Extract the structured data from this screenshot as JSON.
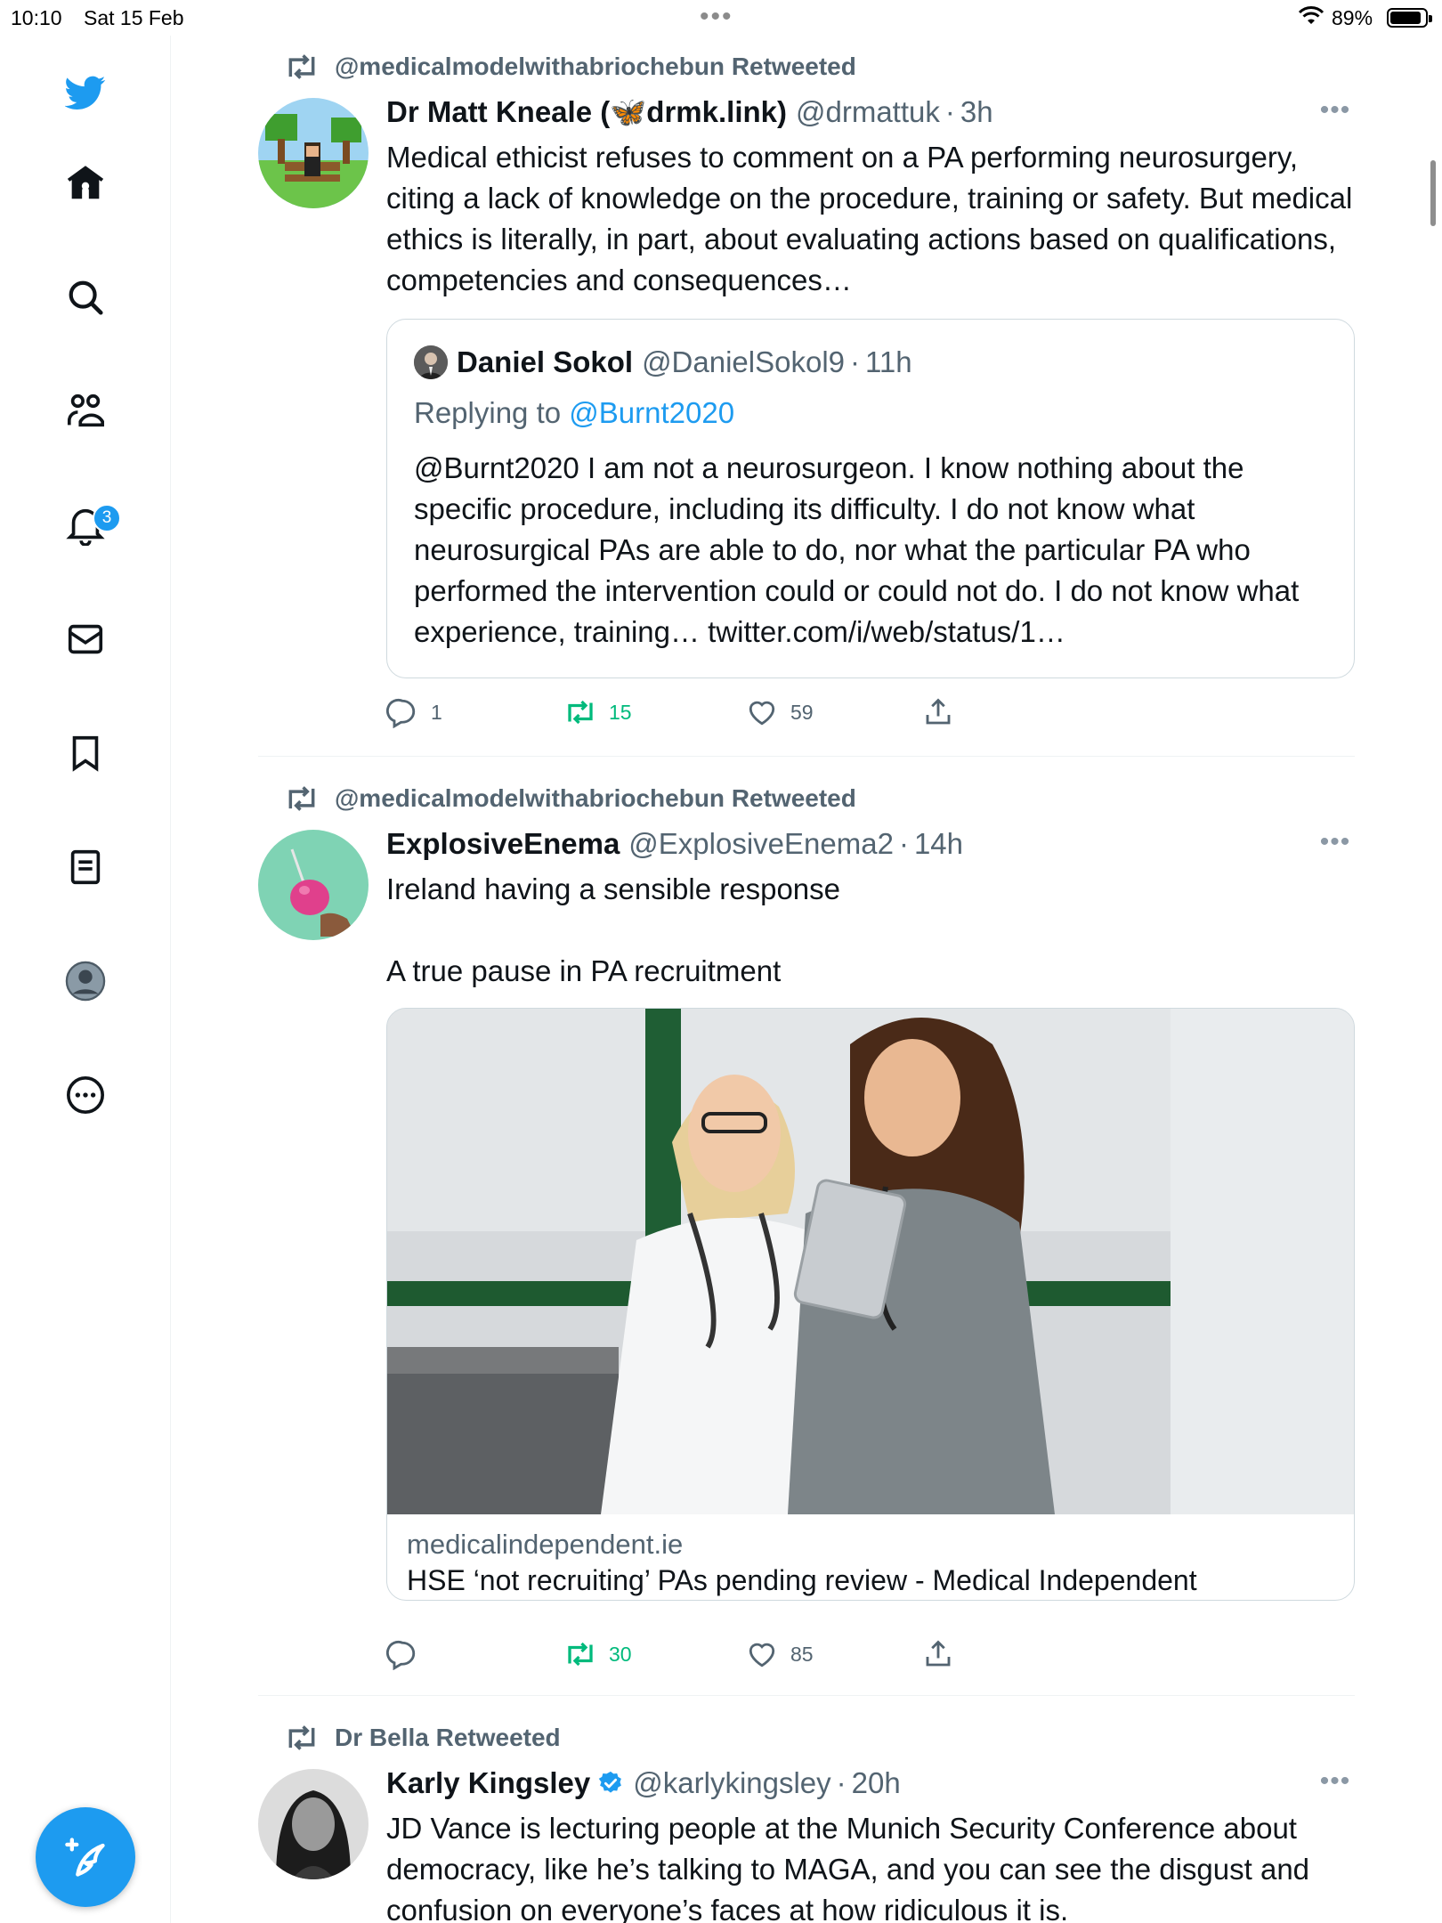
{
  "status_bar": {
    "time": "10:10",
    "date": "Sat 15 Feb",
    "battery_percent": "89%",
    "battery_level": 0.89
  },
  "sidebar": {
    "items": [
      {
        "icon": "twitter-bird-icon"
      },
      {
        "icon": "home-icon"
      },
      {
        "icon": "search-icon"
      },
      {
        "icon": "communities-icon"
      },
      {
        "icon": "notifications-icon",
        "badge": "3"
      },
      {
        "icon": "messages-icon"
      },
      {
        "icon": "bookmarks-icon"
      },
      {
        "icon": "lists-icon"
      },
      {
        "icon": "profile-icon"
      },
      {
        "icon": "more-icon"
      }
    ],
    "compose_icon": "compose-tweet-icon",
    "accent": "#1d9bf0"
  },
  "tweets": [
    {
      "retweeted_by": "@medicalmodelwithabriochebun Retweeted",
      "name": "Dr Matt Kneale (🦋drmk.link)",
      "handle": "@drmattuk",
      "separator": "·",
      "time": "3h",
      "text": "Medical ethicist refuses to comment on a PA performing neurosurgery, citing a lack of knowledge on the procedure, training or safety. But medical ethics is literally, in part, about evaluating actions based on qualifications, competencies and consequences…",
      "quote": {
        "name": "Daniel Sokol",
        "handle": "@DanielSokol9",
        "separator": "·",
        "time": "11h",
        "replying_prefix": "Replying to ",
        "replying_to": "@Burnt2020",
        "text": "@Burnt2020 I am not a neurosurgeon. I know nothing about the specific procedure, including its difficulty. I do not know what neurosurgical PAs are able to do, nor what the particular PA who performed the intervention could or could not do. I do not know what experience, training… twitter.com/i/web/status/1…"
      },
      "replies": "1",
      "retweets": "15",
      "likes": "59"
    },
    {
      "retweeted_by": "@medicalmodelwithabriochebun Retweeted",
      "name": "ExplosiveEnema",
      "handle": "@ExplosiveEnema2",
      "separator": "·",
      "time": "14h",
      "text": "Ireland having a sensible response\n\nA true pause in PA recruitment",
      "card": {
        "domain": "medicalindependent.ie",
        "title": "HSE ‘not recruiting’ PAs pending review - Medical Independent"
      },
      "replies": "",
      "retweets": "30",
      "likes": "85"
    },
    {
      "retweeted_by": "Dr Bella Retweeted",
      "name": "Karly Kingsley",
      "handle": "@karlykingsley",
      "separator": "·",
      "time": "20h",
      "verified": true,
      "text": "JD Vance is lecturing people at the Munich Security Conference about democracy, like he’s talking to MAGA, and you can see the disgust and confusion on everyone’s faces at how ridiculous it is."
    }
  ],
  "colors": {
    "retweet_green": "#00ba7c",
    "secondary_text": "#536471",
    "link_blue": "#1d9bf0"
  }
}
